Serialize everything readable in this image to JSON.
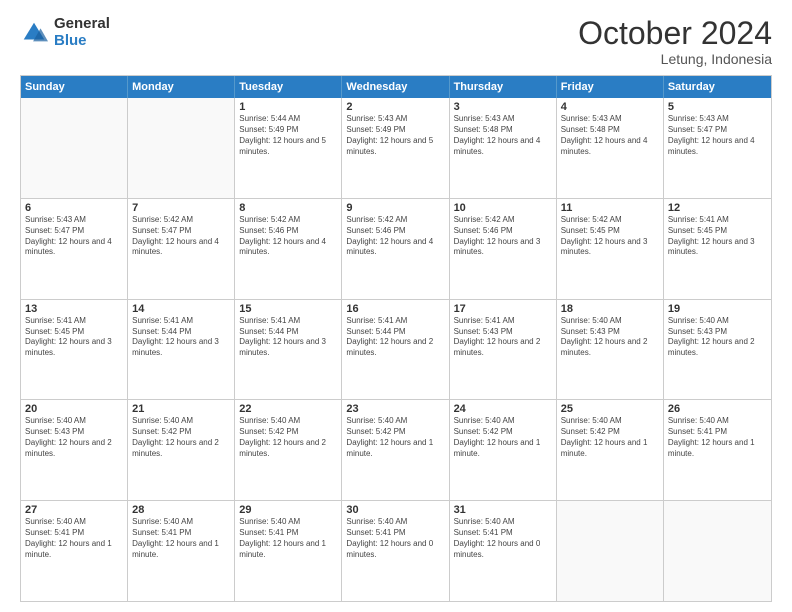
{
  "logo": {
    "general": "General",
    "blue": "Blue"
  },
  "header": {
    "month": "October 2024",
    "location": "Letung, Indonesia"
  },
  "days": [
    "Sunday",
    "Monday",
    "Tuesday",
    "Wednesday",
    "Thursday",
    "Friday",
    "Saturday"
  ],
  "weeks": [
    [
      {
        "day": "",
        "empty": true
      },
      {
        "day": "",
        "empty": true
      },
      {
        "day": "1",
        "sunrise": "Sunrise: 5:44 AM",
        "sunset": "Sunset: 5:49 PM",
        "daylight": "Daylight: 12 hours and 5 minutes."
      },
      {
        "day": "2",
        "sunrise": "Sunrise: 5:43 AM",
        "sunset": "Sunset: 5:49 PM",
        "daylight": "Daylight: 12 hours and 5 minutes."
      },
      {
        "day": "3",
        "sunrise": "Sunrise: 5:43 AM",
        "sunset": "Sunset: 5:48 PM",
        "daylight": "Daylight: 12 hours and 4 minutes."
      },
      {
        "day": "4",
        "sunrise": "Sunrise: 5:43 AM",
        "sunset": "Sunset: 5:48 PM",
        "daylight": "Daylight: 12 hours and 4 minutes."
      },
      {
        "day": "5",
        "sunrise": "Sunrise: 5:43 AM",
        "sunset": "Sunset: 5:47 PM",
        "daylight": "Daylight: 12 hours and 4 minutes."
      }
    ],
    [
      {
        "day": "6",
        "sunrise": "Sunrise: 5:43 AM",
        "sunset": "Sunset: 5:47 PM",
        "daylight": "Daylight: 12 hours and 4 minutes."
      },
      {
        "day": "7",
        "sunrise": "Sunrise: 5:42 AM",
        "sunset": "Sunset: 5:47 PM",
        "daylight": "Daylight: 12 hours and 4 minutes."
      },
      {
        "day": "8",
        "sunrise": "Sunrise: 5:42 AM",
        "sunset": "Sunset: 5:46 PM",
        "daylight": "Daylight: 12 hours and 4 minutes."
      },
      {
        "day": "9",
        "sunrise": "Sunrise: 5:42 AM",
        "sunset": "Sunset: 5:46 PM",
        "daylight": "Daylight: 12 hours and 4 minutes."
      },
      {
        "day": "10",
        "sunrise": "Sunrise: 5:42 AM",
        "sunset": "Sunset: 5:46 PM",
        "daylight": "Daylight: 12 hours and 3 minutes."
      },
      {
        "day": "11",
        "sunrise": "Sunrise: 5:42 AM",
        "sunset": "Sunset: 5:45 PM",
        "daylight": "Daylight: 12 hours and 3 minutes."
      },
      {
        "day": "12",
        "sunrise": "Sunrise: 5:41 AM",
        "sunset": "Sunset: 5:45 PM",
        "daylight": "Daylight: 12 hours and 3 minutes."
      }
    ],
    [
      {
        "day": "13",
        "sunrise": "Sunrise: 5:41 AM",
        "sunset": "Sunset: 5:45 PM",
        "daylight": "Daylight: 12 hours and 3 minutes."
      },
      {
        "day": "14",
        "sunrise": "Sunrise: 5:41 AM",
        "sunset": "Sunset: 5:44 PM",
        "daylight": "Daylight: 12 hours and 3 minutes."
      },
      {
        "day": "15",
        "sunrise": "Sunrise: 5:41 AM",
        "sunset": "Sunset: 5:44 PM",
        "daylight": "Daylight: 12 hours and 3 minutes."
      },
      {
        "day": "16",
        "sunrise": "Sunrise: 5:41 AM",
        "sunset": "Sunset: 5:44 PM",
        "daylight": "Daylight: 12 hours and 2 minutes."
      },
      {
        "day": "17",
        "sunrise": "Sunrise: 5:41 AM",
        "sunset": "Sunset: 5:43 PM",
        "daylight": "Daylight: 12 hours and 2 minutes."
      },
      {
        "day": "18",
        "sunrise": "Sunrise: 5:40 AM",
        "sunset": "Sunset: 5:43 PM",
        "daylight": "Daylight: 12 hours and 2 minutes."
      },
      {
        "day": "19",
        "sunrise": "Sunrise: 5:40 AM",
        "sunset": "Sunset: 5:43 PM",
        "daylight": "Daylight: 12 hours and 2 minutes."
      }
    ],
    [
      {
        "day": "20",
        "sunrise": "Sunrise: 5:40 AM",
        "sunset": "Sunset: 5:43 PM",
        "daylight": "Daylight: 12 hours and 2 minutes."
      },
      {
        "day": "21",
        "sunrise": "Sunrise: 5:40 AM",
        "sunset": "Sunset: 5:42 PM",
        "daylight": "Daylight: 12 hours and 2 minutes."
      },
      {
        "day": "22",
        "sunrise": "Sunrise: 5:40 AM",
        "sunset": "Sunset: 5:42 PM",
        "daylight": "Daylight: 12 hours and 2 minutes."
      },
      {
        "day": "23",
        "sunrise": "Sunrise: 5:40 AM",
        "sunset": "Sunset: 5:42 PM",
        "daylight": "Daylight: 12 hours and 1 minute."
      },
      {
        "day": "24",
        "sunrise": "Sunrise: 5:40 AM",
        "sunset": "Sunset: 5:42 PM",
        "daylight": "Daylight: 12 hours and 1 minute."
      },
      {
        "day": "25",
        "sunrise": "Sunrise: 5:40 AM",
        "sunset": "Sunset: 5:42 PM",
        "daylight": "Daylight: 12 hours and 1 minute."
      },
      {
        "day": "26",
        "sunrise": "Sunrise: 5:40 AM",
        "sunset": "Sunset: 5:41 PM",
        "daylight": "Daylight: 12 hours and 1 minute."
      }
    ],
    [
      {
        "day": "27",
        "sunrise": "Sunrise: 5:40 AM",
        "sunset": "Sunset: 5:41 PM",
        "daylight": "Daylight: 12 hours and 1 minute."
      },
      {
        "day": "28",
        "sunrise": "Sunrise: 5:40 AM",
        "sunset": "Sunset: 5:41 PM",
        "daylight": "Daylight: 12 hours and 1 minute."
      },
      {
        "day": "29",
        "sunrise": "Sunrise: 5:40 AM",
        "sunset": "Sunset: 5:41 PM",
        "daylight": "Daylight: 12 hours and 1 minute."
      },
      {
        "day": "30",
        "sunrise": "Sunrise: 5:40 AM",
        "sunset": "Sunset: 5:41 PM",
        "daylight": "Daylight: 12 hours and 0 minutes."
      },
      {
        "day": "31",
        "sunrise": "Sunrise: 5:40 AM",
        "sunset": "Sunset: 5:41 PM",
        "daylight": "Daylight: 12 hours and 0 minutes."
      },
      {
        "day": "",
        "empty": true
      },
      {
        "day": "",
        "empty": true
      }
    ]
  ]
}
